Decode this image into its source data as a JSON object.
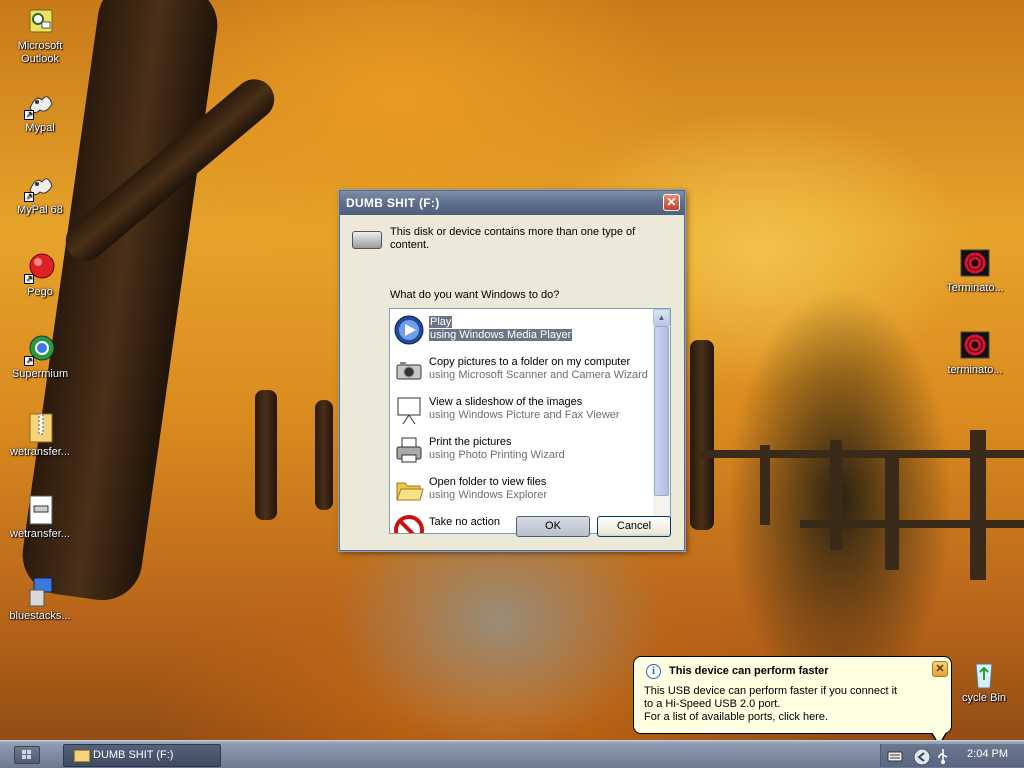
{
  "desktop": {
    "icons_left": [
      {
        "label": "Microsoft Outlook",
        "icon": "outlook-icon"
      },
      {
        "label": "Mypal",
        "icon": "mypal-icon"
      },
      {
        "label": "MyPal 68",
        "icon": "mypal-icon"
      },
      {
        "label": "Pego",
        "icon": "pego-icon"
      },
      {
        "label": "Supermium",
        "icon": "supermium-icon"
      },
      {
        "label": "wetransfer...",
        "icon": "zip-icon"
      },
      {
        "label": "wetransfer...",
        "icon": "document-icon"
      },
      {
        "label": "bluestacks...",
        "icon": "installer-icon"
      }
    ],
    "icons_right": [
      {
        "label": "Terminato...",
        "icon": "video-icon"
      },
      {
        "label": "terminato...",
        "icon": "video-icon"
      },
      {
        "label": "cycle Bin",
        "icon": "recycle-bin-icon"
      }
    ]
  },
  "dialog": {
    "title": "DUMB SHIT (F:)",
    "close_label": "✕",
    "message": "This disk or device contains more than one type of content.",
    "question": "What do you want Windows to do?",
    "options": [
      {
        "title": "Play",
        "subtitle": "using Windows Media Player",
        "icon": "media-player-icon",
        "selected": true
      },
      {
        "title": "Copy pictures to a folder on my computer",
        "subtitle": "using Microsoft Scanner and Camera Wizard",
        "icon": "camera-icon",
        "selected": false
      },
      {
        "title": "View a slideshow of the images",
        "subtitle": "using Windows Picture and Fax Viewer",
        "icon": "projector-icon",
        "selected": false
      },
      {
        "title": "Print the pictures",
        "subtitle": "using Photo Printing Wizard",
        "icon": "printer-icon",
        "selected": false
      },
      {
        "title": "Open folder to view files",
        "subtitle": "using Windows Explorer",
        "icon": "folder-icon",
        "selected": false
      },
      {
        "title": "Take no action",
        "subtitle": "",
        "icon": "no-action-icon",
        "selected": false
      }
    ],
    "ok_label": "OK",
    "cancel_label": "Cancel"
  },
  "balloon": {
    "title": "This device can perform faster",
    "line1": "This USB device can perform faster if you connect it",
    "line2": "to a Hi-Speed USB 2.0 port.",
    "line3": "For a list of available ports, click here.",
    "close_label": "✕",
    "info_label": "i"
  },
  "taskbar": {
    "task_label": "DUMB SHIT (F:)",
    "clock": "2:04 PM"
  },
  "colors": {
    "title_bar": "#5d6f8c",
    "selection": "#6b7586",
    "balloon_bg": "#ffffe1",
    "taskbar": "#7d899f"
  }
}
